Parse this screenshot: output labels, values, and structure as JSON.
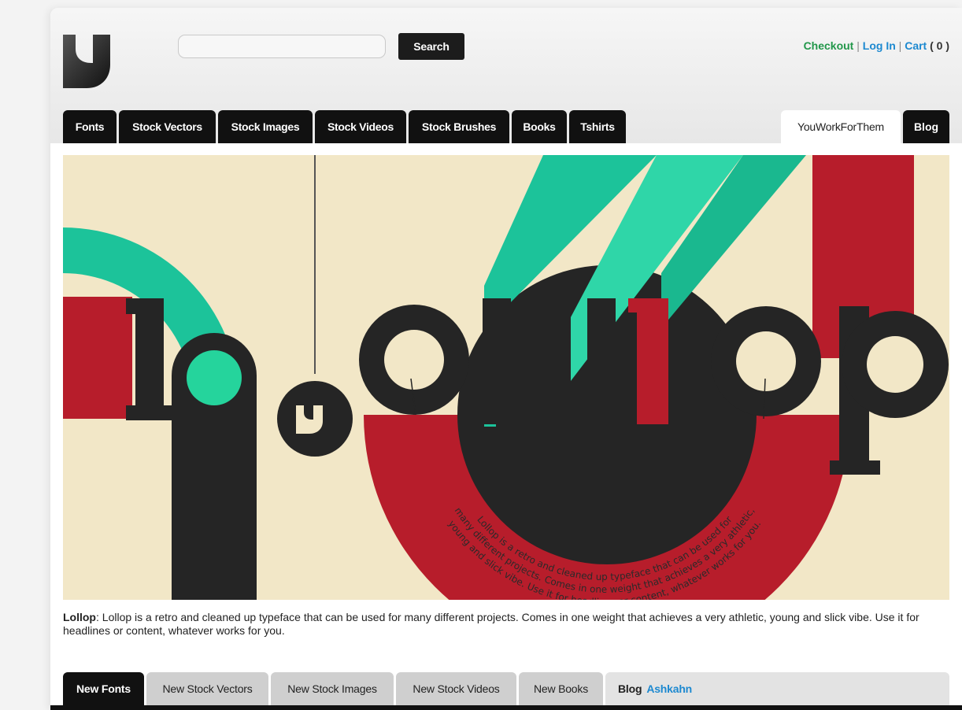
{
  "header": {
    "search": {
      "value": "",
      "placeholder": ""
    },
    "search_button": "Search",
    "account": {
      "checkout": "Checkout",
      "separator": "|",
      "login": "Log In",
      "cart": "Cart",
      "cart_count": "( 0 )"
    }
  },
  "nav": {
    "tabs": [
      {
        "label": "Fonts"
      },
      {
        "label": "Stock Vectors"
      },
      {
        "label": "Stock Images"
      },
      {
        "label": "Stock Videos"
      },
      {
        "label": "Stock Brushes"
      },
      {
        "label": "Books"
      },
      {
        "label": "Tshirts"
      }
    ],
    "right_tab": "YouWorkForThem",
    "blog_tab": "Blog"
  },
  "banner": {
    "wordmark": "lollop",
    "arc_text_line1": "Lollop is a retro and cleaned up typeface that can be used for",
    "arc_text_line2": "many different projects. Comes in one weight that achieves a very athletic,",
    "arc_text_line3": "young and slick vibe. Use it for headlines or content, whatever works for you.",
    "colors": {
      "cream": "#f2e7c7",
      "red": "#b71d2b",
      "teal": "#1cc39a",
      "dark": "#252525"
    }
  },
  "description": {
    "title": "Lollop",
    "text": ": Lollop is a retro and cleaned up typeface that can be used for many different projects. Comes in one weight that achieves a very athletic, young and slick vibe. Use it for headlines or content, whatever works for you."
  },
  "bottom_tabs": {
    "tabs": [
      {
        "label": "New Fonts"
      },
      {
        "label": "New Stock Vectors"
      },
      {
        "label": "New Stock Images"
      },
      {
        "label": "New Stock Videos"
      },
      {
        "label": "New Books"
      }
    ],
    "blog_label": "Blog",
    "blog_author": "Ashkahn"
  }
}
